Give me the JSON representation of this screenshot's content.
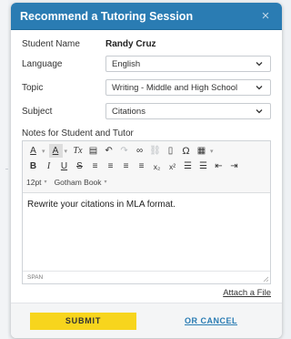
{
  "dialog": {
    "title": "Recommend a Tutoring Session",
    "close_glyph": "×"
  },
  "student": {
    "label": "Student Name",
    "value": "Randy Cruz"
  },
  "language": {
    "label": "Language",
    "value": "English"
  },
  "topic": {
    "label": "Topic",
    "value": "Writing - Middle and High School"
  },
  "subject": {
    "label": "Subject",
    "value": "Citations"
  },
  "notes": {
    "label": "Notes for Student and Tutor",
    "content": "Rewrite your citations in MLA format.",
    "status_path": "SPAN",
    "font_size": "12pt",
    "font_family": "Gotham Book"
  },
  "toolbar": {
    "row1": [
      {
        "name": "font-color-icon",
        "glyph": "A"
      },
      {
        "name": "background-color-icon",
        "glyph": "A"
      },
      {
        "name": "remove-format-icon",
        "glyph": "Tx"
      },
      {
        "name": "paste-icon",
        "glyph": "▤"
      },
      {
        "name": "undo-icon",
        "glyph": "↶"
      },
      {
        "name": "redo-icon",
        "glyph": "↷"
      },
      {
        "name": "link-icon",
        "glyph": "∞"
      },
      {
        "name": "unlink-icon",
        "glyph": "⛓"
      },
      {
        "name": "bookmark-icon",
        "glyph": "▯"
      },
      {
        "name": "special-char-icon",
        "glyph": "Ω"
      },
      {
        "name": "table-icon",
        "glyph": "▦"
      }
    ],
    "row2": [
      {
        "name": "bold-icon",
        "glyph": "B"
      },
      {
        "name": "italic-icon",
        "glyph": "I"
      },
      {
        "name": "underline-icon",
        "glyph": "U"
      },
      {
        "name": "strikethrough-icon",
        "glyph": "S"
      },
      {
        "name": "align-left-icon",
        "glyph": "≡"
      },
      {
        "name": "align-center-icon",
        "glyph": "≡"
      },
      {
        "name": "align-right-icon",
        "glyph": "≡"
      },
      {
        "name": "align-justify-icon",
        "glyph": "≡"
      },
      {
        "name": "subscript-icon",
        "glyph": "x₂"
      },
      {
        "name": "superscript-icon",
        "glyph": "x²"
      },
      {
        "name": "numbered-list-icon",
        "glyph": "☰"
      },
      {
        "name": "bulleted-list-icon",
        "glyph": "☰"
      },
      {
        "name": "outdent-icon",
        "glyph": "⇤"
      },
      {
        "name": "indent-icon",
        "glyph": "⇥"
      }
    ]
  },
  "attach_label": "Attach a File",
  "actions": {
    "submit": "SUBMIT",
    "cancel": "OR CANCEL"
  },
  "colors": {
    "header": "#2a7cb3",
    "submit": "#f7d51d",
    "link": "#2a7cb3"
  }
}
